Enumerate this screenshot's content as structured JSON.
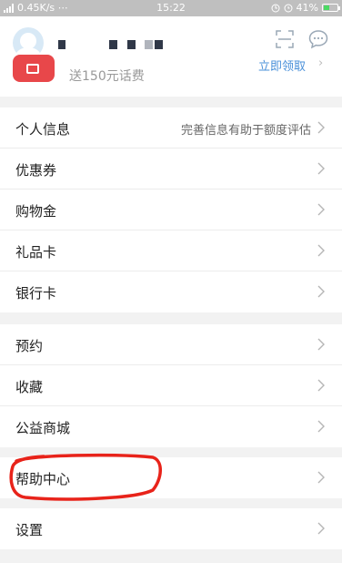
{
  "status_bar": {
    "network": "0.45K/s ⋯",
    "time": "15:22",
    "battery": "41%",
    "battery_level": 0.41,
    "icons": [
      "signal-icon",
      "alarm-icon",
      "clock-icon",
      "battery-icon"
    ]
  },
  "header": {
    "avatar_icon": "default-user-avatar",
    "scan_icon": "scan-icon",
    "chat_icon": "chat-bubble-icon",
    "promo": {
      "icon": "red-card-icon",
      "text": "送150元话费",
      "link": "立即领取"
    }
  },
  "menu": {
    "group1": [
      {
        "label": "个人信息",
        "hint": "完善信息有助于额度评估"
      },
      {
        "label": "优惠券"
      },
      {
        "label": "购物金"
      },
      {
        "label": "礼品卡"
      },
      {
        "label": "银行卡"
      }
    ],
    "group2": [
      {
        "label": "预约"
      },
      {
        "label": "收藏"
      },
      {
        "label": "公益商城"
      }
    ],
    "group3": [
      {
        "label": "帮助中心"
      }
    ],
    "group4": [
      {
        "label": "设置"
      }
    ]
  },
  "annotation": {
    "shape": "hand-drawn-ellipse",
    "color": "#e8231a"
  },
  "colors": {
    "link": "#4a90d9",
    "promo_red": "#e8474a",
    "background": "#f2f2f2"
  }
}
